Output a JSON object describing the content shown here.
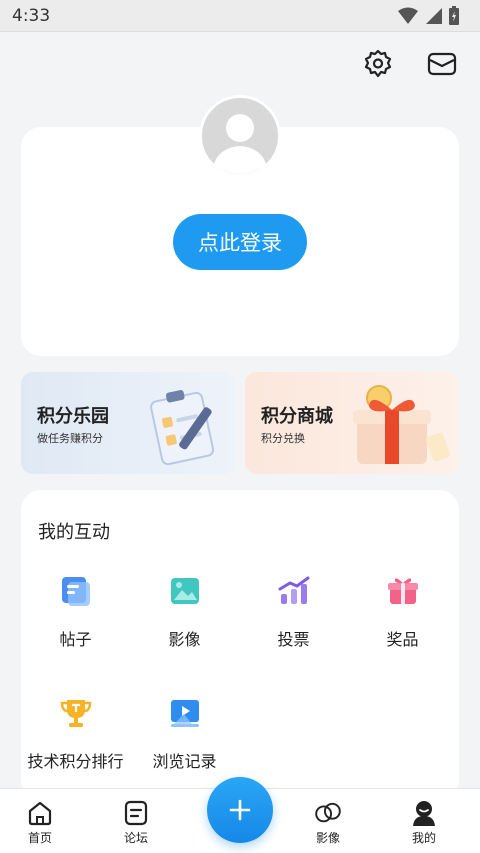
{
  "status_bar": {
    "time": "4:33"
  },
  "header": {
    "settings_icon": "gear-icon",
    "message_icon": "mail-icon"
  },
  "login": {
    "button_label": "点此登录"
  },
  "promos": [
    {
      "title": "积分乐园",
      "subtitle": "做任务赚积分"
    },
    {
      "title": "积分商城",
      "subtitle": "积分兑换"
    }
  ],
  "interaction": {
    "title": "我的互动",
    "items": [
      {
        "label": "帖子",
        "icon": "posts-icon"
      },
      {
        "label": "影像",
        "icon": "image-icon"
      },
      {
        "label": "投票",
        "icon": "vote-icon"
      },
      {
        "label": "奖品",
        "icon": "gift-icon"
      },
      {
        "label": "技术积分排行",
        "icon": "trophy-icon"
      },
      {
        "label": "浏览记录",
        "icon": "history-icon"
      }
    ]
  },
  "bottom_nav": {
    "tabs": [
      {
        "label": "首页",
        "icon": "home-icon"
      },
      {
        "label": "论坛",
        "icon": "forum-icon"
      },
      {
        "label": "影像",
        "icon": "link-rings-icon"
      },
      {
        "label": "我的",
        "icon": "profile-icon"
      }
    ],
    "fab_icon": "plus-icon"
  },
  "colors": {
    "accent": "#1e9bf0",
    "background": "#f3f4f6"
  }
}
